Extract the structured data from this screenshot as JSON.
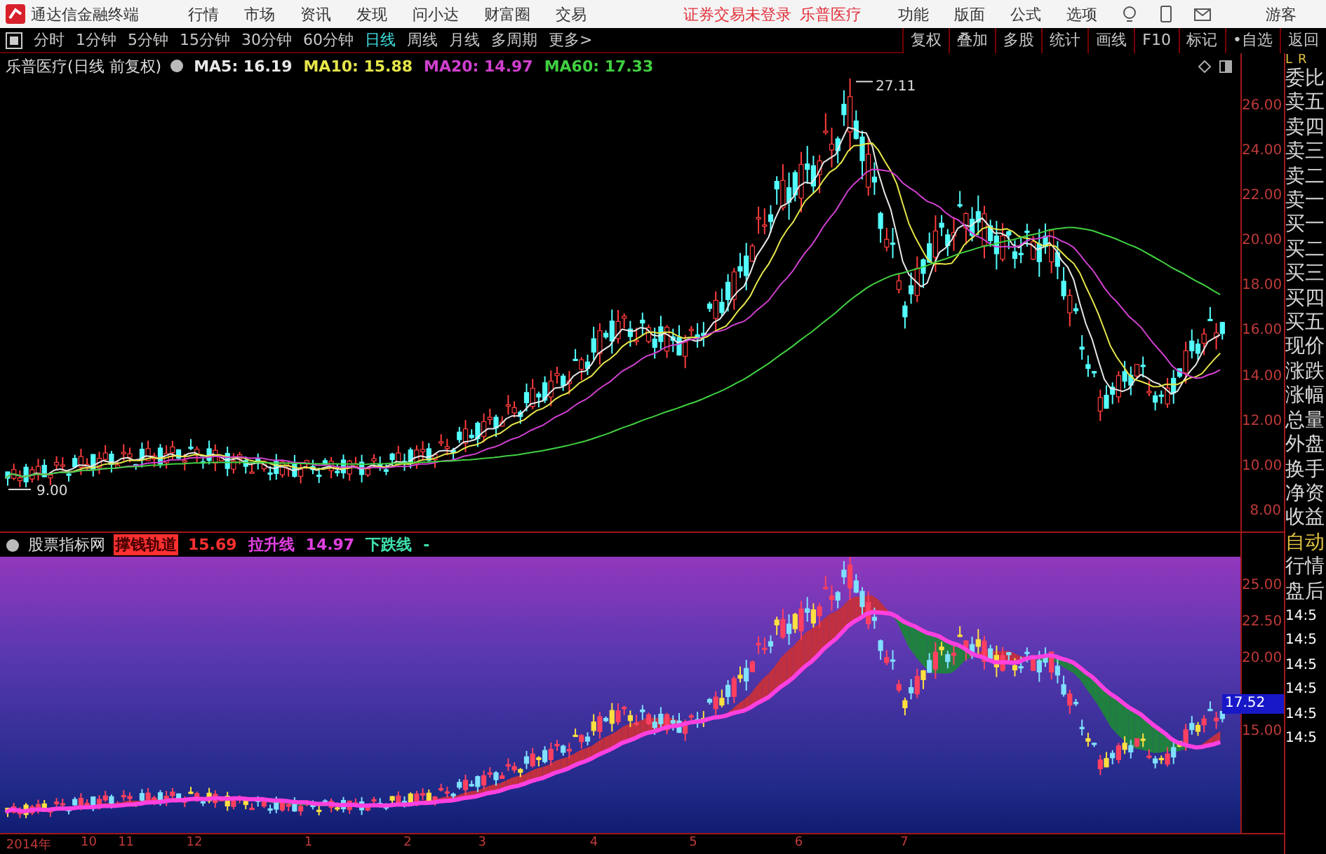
{
  "app": {
    "title": "通达信金融终端",
    "menu": [
      "行情",
      "市场",
      "资讯",
      "发现",
      "问小达",
      "财富圈",
      "交易"
    ],
    "notice": "证券交易未登录",
    "stock_name": "乐普医疗",
    "tools": [
      "功能",
      "版面",
      "公式",
      "选项"
    ],
    "user": "游客"
  },
  "periods": [
    {
      "label": "分时",
      "selected": false
    },
    {
      "label": "1分钟",
      "selected": false
    },
    {
      "label": "5分钟",
      "selected": false
    },
    {
      "label": "15分钟",
      "selected": false
    },
    {
      "label": "30分钟",
      "selected": false
    },
    {
      "label": "60分钟",
      "selected": false
    },
    {
      "label": "日线",
      "selected": true
    },
    {
      "label": "周线",
      "selected": false
    },
    {
      "label": "月线",
      "selected": false
    },
    {
      "label": "多周期",
      "selected": false
    },
    {
      "label": "更多>",
      "selected": false
    }
  ],
  "chart_buttons": [
    "复权",
    "叠加",
    "多股",
    "统计",
    "画线",
    "F10",
    "标记",
    "•自选",
    "返回"
  ],
  "price_chart": {
    "title": "乐普医疗(日线 前复权)",
    "legend": [
      {
        "label": "MA5: 16.19",
        "color": "#e8e8e8"
      },
      {
        "label": "MA10: 15.88",
        "color": "#e6e64a"
      },
      {
        "label": "MA20: 14.97",
        "color": "#d040d0"
      },
      {
        "label": "MA60: 17.33",
        "color": "#40d040"
      }
    ],
    "high_label": "27.11",
    "low_label": "9.00",
    "y_ticks": [
      "26.00",
      "24.00",
      "22.00",
      "20.00",
      "18.00",
      "16.00",
      "14.00",
      "12.00",
      "10.00",
      "8.00"
    ]
  },
  "indicator": {
    "title": "股票指标网",
    "legend": [
      {
        "label": "撑钱轨道",
        "color": "#ff3030",
        "boxed": true
      },
      {
        "label": "15.69",
        "color": "#ff3030",
        "boxed": false
      },
      {
        "label": "拉升线",
        "color": "#e040e0",
        "boxed": false
      },
      {
        "label": "14.97",
        "color": "#e040e0",
        "boxed": false
      },
      {
        "label": "下跌线",
        "color": "#40e0b0",
        "boxed": false
      },
      {
        "label": "-",
        "color": "#40e0b0",
        "boxed": false
      }
    ],
    "y_ticks": [
      {
        "label": "25.00",
        "current": false
      },
      {
        "label": "22.50",
        "current": false
      },
      {
        "label": "20.00",
        "current": false
      },
      {
        "label": "17.52",
        "current": true
      },
      {
        "label": "15.00",
        "current": false
      }
    ]
  },
  "x_axis": [
    "2014年",
    "10",
    "11",
    "12",
    "1",
    "2",
    "3",
    "4",
    "5",
    "6",
    "7"
  ],
  "side_panel": {
    "marks": [
      "L",
      "R"
    ],
    "rows": [
      "委比",
      "卖五",
      "卖四",
      "卖三",
      "卖二",
      "卖一",
      "买一",
      "买二",
      "买三",
      "买四",
      "买五",
      "现价",
      "涨跌",
      "涨幅",
      "总量",
      "外盘",
      "换手",
      "净资",
      "收益"
    ],
    "modes": [
      "自动",
      "行情",
      "盘后"
    ],
    "times": [
      "14:5",
      "14:5",
      "14:5",
      "14:5",
      "14:5",
      "14:5"
    ]
  }
}
